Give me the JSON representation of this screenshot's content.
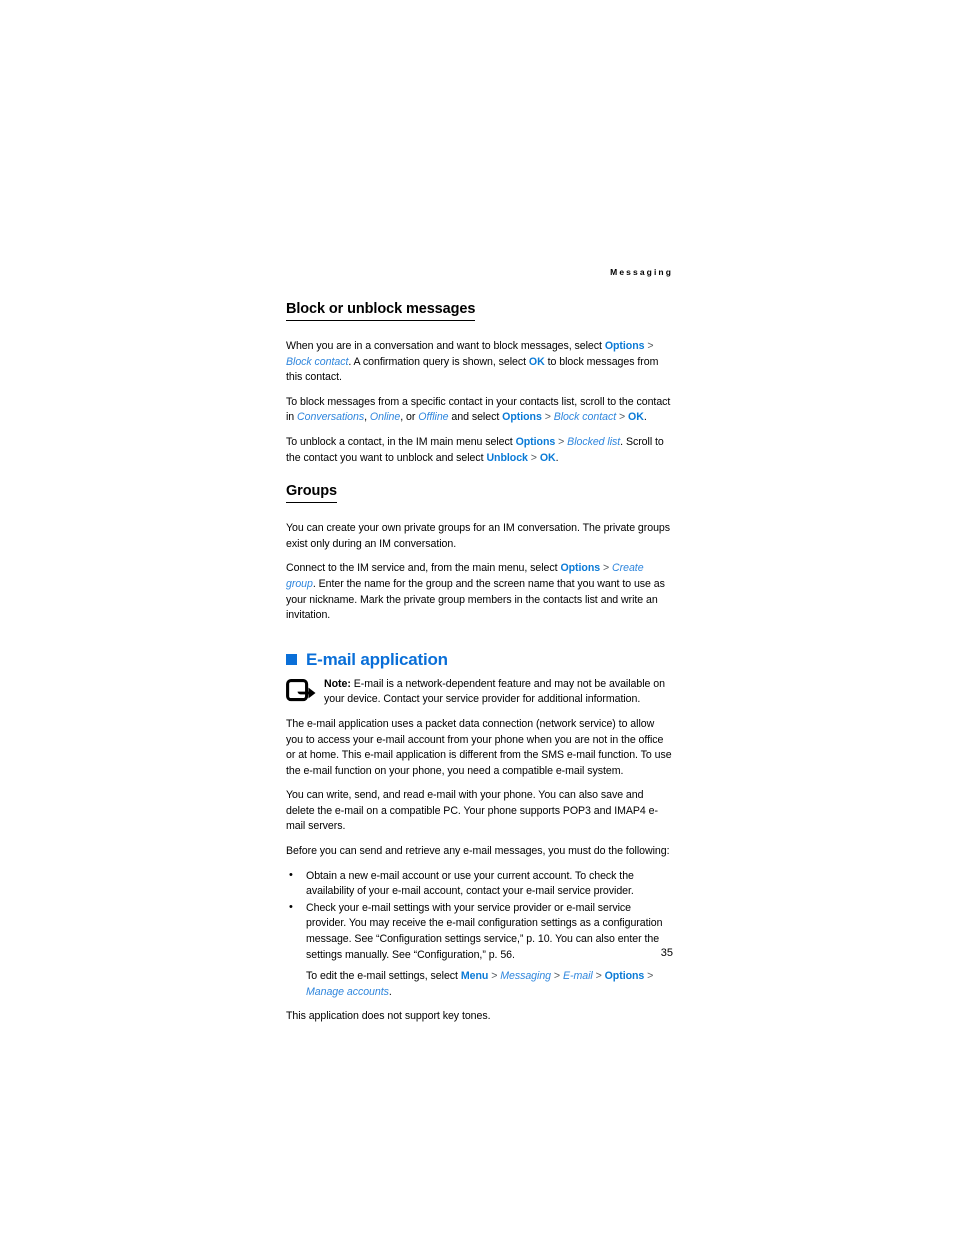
{
  "document": {
    "running_header": "Messaging",
    "page_number": "35"
  },
  "sections": {
    "block_unblock": {
      "heading": "Block or unblock messages",
      "p1": {
        "t1": "When you are in a conversation and want to block messages, select ",
        "link1": "Options",
        "sep1": " > ",
        "link2": "Block contact",
        "t2": ". A confirmation query is shown, select ",
        "link3": "OK",
        "t3": " to block messages from this contact."
      },
      "p2": {
        "t1": "To block messages from a specific contact in your contacts list, scroll to the contact in ",
        "link1": "Conversations",
        "t2": ", ",
        "link2": "Online",
        "t3": ", or ",
        "link3": "Offline",
        "t4": " and select ",
        "link4": "Options",
        "sep1": " > ",
        "link5": "Block contact",
        "sep2": " > ",
        "link6": "OK",
        "t5": "."
      },
      "p3": {
        "t1": "To unblock a contact, in the IM main menu select ",
        "link1": "Options",
        "sep1": " > ",
        "link2": "Blocked list",
        "t2": ". Scroll to the contact you want to unblock and select ",
        "link3": "Unblock",
        "sep2": " > ",
        "link4": "OK",
        "t3": "."
      }
    },
    "groups": {
      "heading": "Groups",
      "p1": "You can create your own private groups for an IM conversation. The private groups exist only during an IM conversation.",
      "p2": {
        "t1": "Connect to the IM service and, from the main menu, select ",
        "link1": "Options",
        "sep1": " > ",
        "link2": "Create group",
        "t2": ". Enter the name for the group and the screen name that you want to use as your nickname. Mark the private group members in the contacts list and write an invitation."
      }
    },
    "email_application": {
      "heading": "E-mail application",
      "note": {
        "label": "Note:",
        "text": " E-mail is a network-dependent feature and may not be available on your device. Contact your service provider for additional information.",
        "icon": "note-arrow-icon"
      },
      "p1": "The e-mail application uses a packet data connection (network service) to allow you to access your e-mail account from your phone when you are not in the office or at home. This e-mail application is different from the SMS e-mail function. To use the e-mail function on your phone, you need a compatible e-mail system.",
      "p2": "You can write, send, and read e-mail with your phone. You can also save and delete the e-mail on a compatible PC. Your phone supports POP3 and IMAP4 e-mail servers.",
      "p3": "Before you can send and retrieve any e-mail messages, you must do the following:",
      "bullets": [
        "Obtain a new e-mail account or use your current account. To check the availability of your e-mail account, contact your e-mail service provider.",
        "Check your e-mail settings with your service provider or e-mail service provider. You may receive the e-mail configuration settings as a configuration message. See “Configuration settings service,” p. 10. You can also enter the settings manually. See “Configuration,” p. 56."
      ],
      "settings_path": {
        "t1": "To edit the e-mail settings, select ",
        "link1": "Menu",
        "sep1": " > ",
        "link2": "Messaging",
        "sep2": " > ",
        "link3": "E-mail",
        "sep3": " > ",
        "link4": "Options",
        "sep4": " > ",
        "link5": "Manage accounts",
        "t2": "."
      },
      "p4": "This application does not support key tones."
    }
  },
  "colors": {
    "link_blue": "#0a7ad6",
    "heading_blue": "#0a6fd8",
    "text_black": "#000000"
  }
}
